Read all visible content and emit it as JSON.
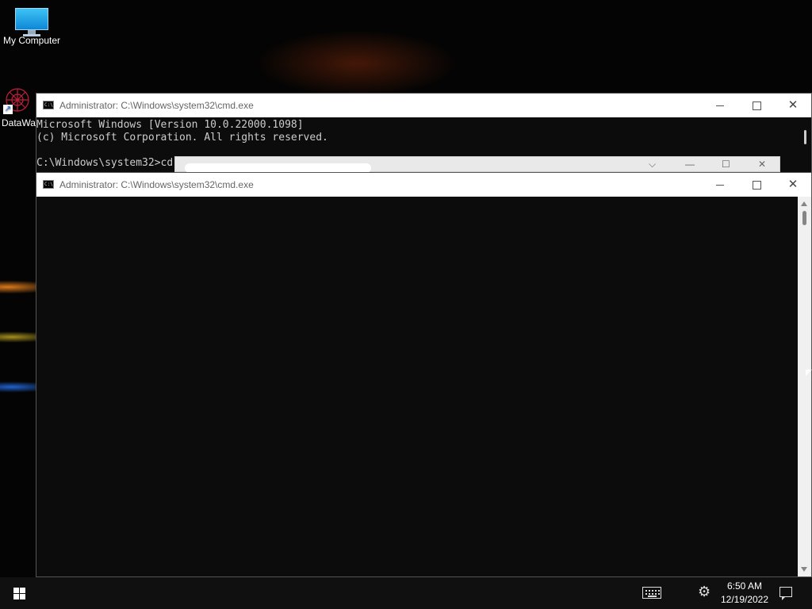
{
  "desktop": {
    "icons": [
      {
        "label": "My Computer",
        "icon": "monitor-icon"
      },
      {
        "label": "DataWa",
        "icon": "datawarrior-icon"
      }
    ]
  },
  "windows": [
    {
      "title": "Administrator: C:\\Windows\\system32\\cmd.exe",
      "console_lines": [
        "Microsoft Windows [Version 10.0.22000.1098]",
        "(c) Microsoft Corporation. All rights reserved.",
        "",
        "C:\\Windows\\system32>cd"
      ]
    },
    {
      "title": "Administrator: C:\\Windows\\system32\\cmd.exe",
      "console_lines": []
    }
  ],
  "window_controls": {
    "minimize": "minimize-icon",
    "maximize": "maximize-icon",
    "close": "close-icon"
  },
  "taskbar": {
    "time": "6:50 AM",
    "date": "12/19/2022",
    "icons": [
      "windows-start-icon",
      "keyboard-icon",
      "settings-gear-icon",
      "notification-icon"
    ]
  },
  "colors": {
    "console_bg": "#0c0c0c",
    "console_text": "#cccccc",
    "titlebar_bg": "#ffffff",
    "taskbar_bg": "#101010"
  }
}
